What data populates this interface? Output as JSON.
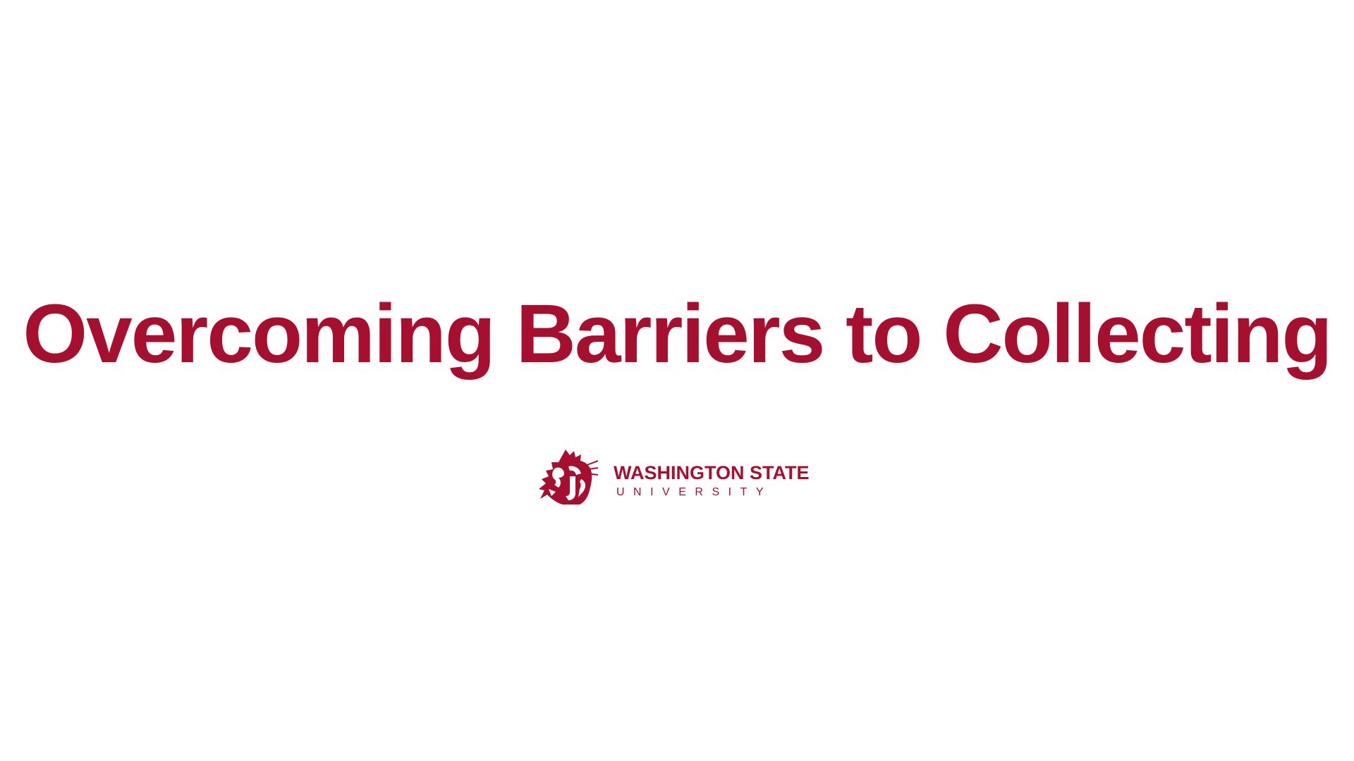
{
  "slide": {
    "title": "Overcoming Barriers to Collecting",
    "brand_color": "#a60f2d",
    "background_color": "#ffffff"
  },
  "logo": {
    "line1": "WASHINGTON STATE",
    "line2": "UNIVERSITY",
    "mark_icon": "cougar-head-icon"
  }
}
